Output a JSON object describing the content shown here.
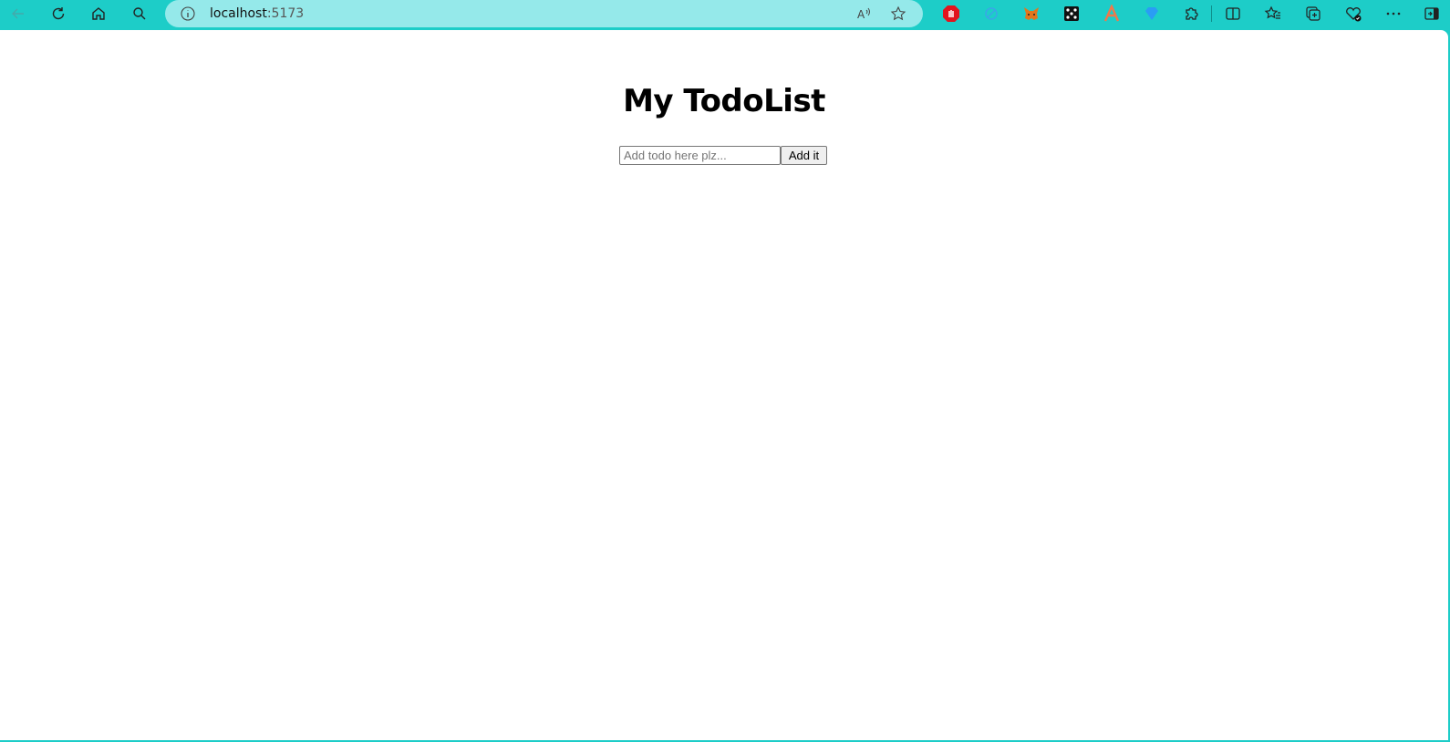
{
  "browser": {
    "url_host": "localhost",
    "url_port": ":5173",
    "toolbar_icons": [
      "back-icon",
      "refresh-icon",
      "home-icon",
      "search-icon"
    ],
    "extension_icons": [
      "adblock-icon",
      "shield-extension-icon",
      "metamask-icon",
      "dice-extension-icon",
      "a-extension-icon",
      "diamond-extension-icon",
      "extensions-puzzle-icon"
    ],
    "right_icons": [
      "split-screen-icon",
      "favorites-icon",
      "collections-icon",
      "browser-essentials-icon",
      "more-icon",
      "sidebar-icon"
    ],
    "accent_color": "#1dcdc8"
  },
  "app": {
    "title": "My TodoList",
    "input_placeholder": "Add todo here plz...",
    "input_value": "",
    "add_button_label": "Add it"
  }
}
